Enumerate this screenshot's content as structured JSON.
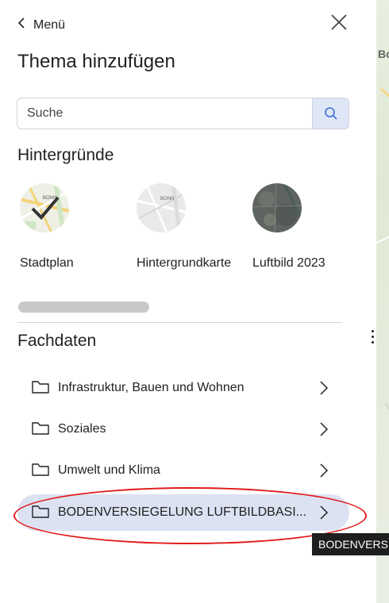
{
  "header": {
    "back_label": "Menü",
    "title": "Thema hinzufügen"
  },
  "search": {
    "placeholder": "Suche",
    "value": ""
  },
  "backgrounds": {
    "heading": "Hintergründe",
    "items": [
      {
        "label": "Stadtplan",
        "selected": true,
        "map_label": "BONN"
      },
      {
        "label": "Hintergrundkarte",
        "selected": false,
        "map_label": "BONN"
      },
      {
        "label": "Luftbild 2023",
        "selected": false
      }
    ]
  },
  "fachdaten": {
    "heading": "Fachdaten",
    "items": [
      {
        "label": "Infrastruktur, Bauen und Wohnen"
      },
      {
        "label": "Soziales"
      },
      {
        "label": "Umwelt und Klima"
      },
      {
        "label": "BODENVERSIEGELUNG LUFTBILDBASI..."
      }
    ]
  },
  "tooltip": {
    "text": "BODENVERSI"
  },
  "map": {
    "edge_text": "Bo"
  },
  "colors": {
    "selected_row": "#dce2f2",
    "search_button": "#dfe7f7",
    "annotation_red": "#e21b1b"
  }
}
